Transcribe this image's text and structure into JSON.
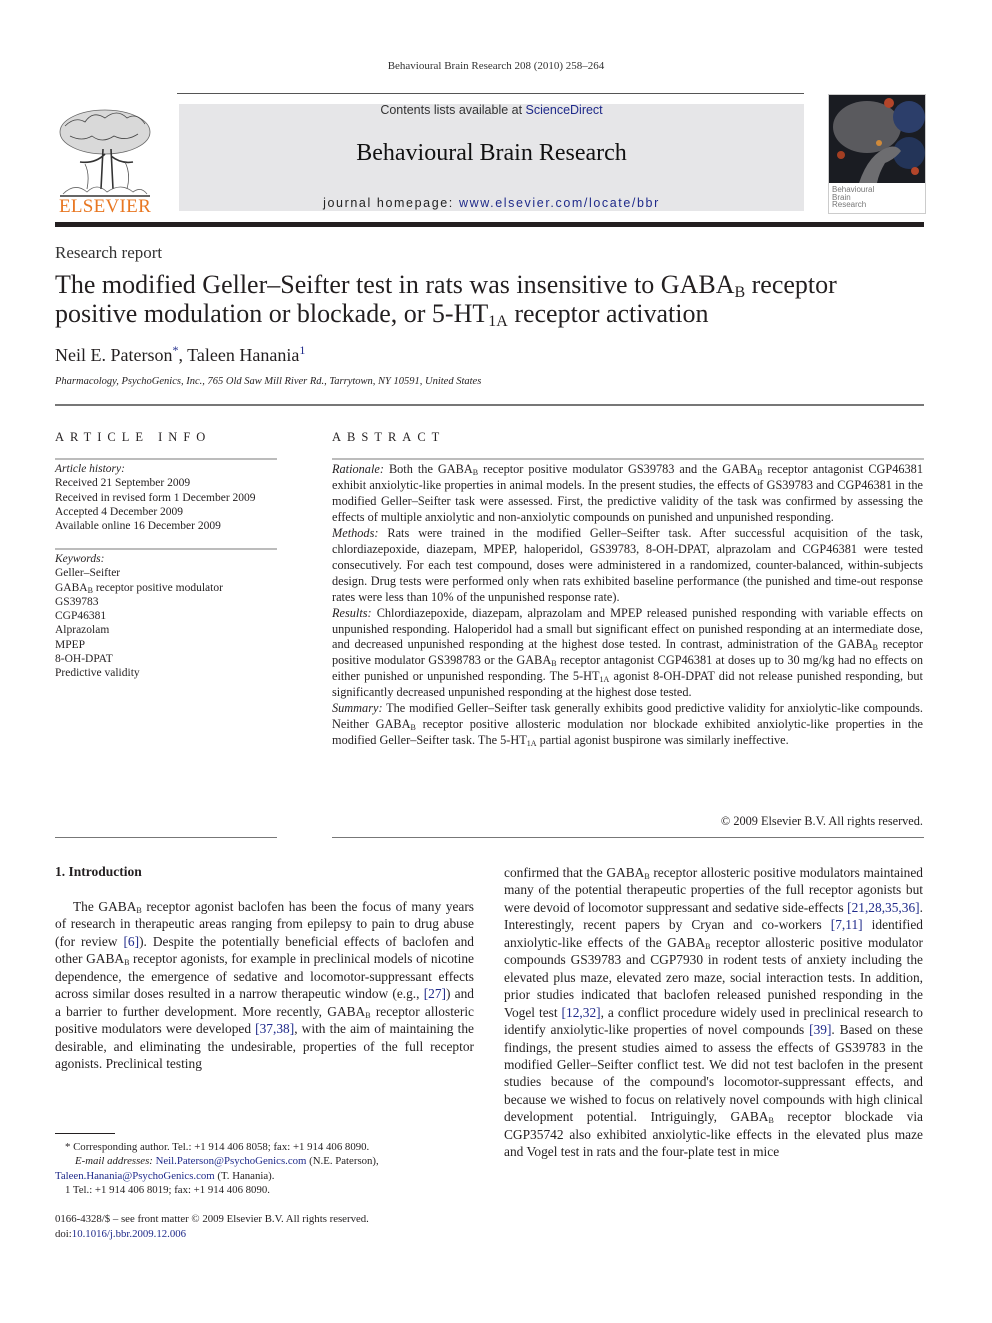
{
  "header": {
    "running_head": "Behavioural Brain Research 208 (2010) 258–264",
    "contents_prefix": "Contents lists available at ",
    "contents_link": "ScienceDirect",
    "journal_title": "Behavioural Brain Research",
    "homepage_prefix": "journal homepage: ",
    "homepage_link": "www.elsevier.com/locate/bbr",
    "publisher_logo_text": "ELSEVIER",
    "cover_text": [
      "Behavioural",
      "Brain",
      "Research"
    ],
    "colors": {
      "elsevier_orange": "#e87722",
      "link_blue": "#1f2a8a",
      "banner_gray": "#e6e6e8"
    }
  },
  "article": {
    "type": "Research report",
    "title_parts": {
      "t1": "The modified Geller–Seifter test in rats was insensitive to GABA",
      "t1_sub": "B",
      "t2": " receptor positive modulation or blockade, or 5-HT",
      "t2_sub": "1A",
      "t3": " receptor activation"
    },
    "authors": [
      {
        "name": "Neil E. Paterson",
        "mark": "*"
      },
      {
        "name": "Taleen Hanania",
        "mark": "1"
      }
    ],
    "author_separator": ", ",
    "affiliation": "Pharmacology, PsychoGenics, Inc., 765 Old Saw Mill River Rd., Tarrytown, NY 10591, United States"
  },
  "article_info": {
    "heading": "ARTICLE INFO",
    "history_label": "Article history:",
    "history": [
      "Received 21 September 2009",
      "Received in revised form 1 December 2009",
      "Accepted 4 December 2009",
      "Available online 16 December 2009"
    ],
    "keywords_label": "Keywords:",
    "keywords": [
      "Geller–Seifter",
      "GABA_B receptor positive modulator",
      "GS39783",
      "CGP46381",
      "Alprazolam",
      "MPEP",
      "8-OH-DPAT",
      "Predictive validity"
    ],
    "keyword_gabab": {
      "pre": "GABA",
      "sub": "B",
      "post": " receptor positive modulator"
    }
  },
  "abstract": {
    "heading": "ABSTRACT",
    "rationale_label": "Rationale:",
    "rationale": {
      "a": " Both the GABA",
      "b": " receptor positive modulator GS39783 and the GABA",
      "c": " receptor antagonist CGP46381 exhibit anxiolytic-like properties in animal models. In the present studies, the effects of GS39783 and CGP46381 in the modified Geller–Seifter task were assessed. First, the predictive validity of the task was confirmed by assessing the effects of multiple anxiolytic and non-anxiolytic compounds on punished and unpunished responding.",
      "sub": "B"
    },
    "methods_label": "Methods:",
    "methods": " Rats were trained in the modified Geller–Seifter task. After successful acquisition of the task, chlordiazepoxide, diazepam, MPEP, haloperidol, GS39783, 8-OH-DPAT, alprazolam and CGP46381 were tested consecutively. For each test compound, doses were administered in a randomized, counter-balanced, within-subjects design. Drug tests were performed only when rats exhibited baseline performance (the punished and time-out response rates were less than 10% of the unpunished response rate).",
    "results_label": "Results:",
    "results": {
      "a": " Chlordiazepoxide, diazepam, alprazolam and MPEP released punished responding with variable effects on unpunished responding. Haloperidol had a small but significant effect on punished responding at an intermediate dose, and decreased unpunished responding at the highest dose tested. In contrast, administration of the GABA",
      "b": " receptor positive modulator GS398783 or the GABA",
      "c": " receptor antagonist CGP46381 at doses up to 30 mg/kg had no effects on either punished or unpunished responding. The 5-HT",
      "d": " agonist 8-OH-DPAT did not release punished responding, but significantly decreased unpunished responding at the highest dose tested.",
      "sub_b": "B",
      "sub_1a": "1A"
    },
    "summary_label": "Summary:",
    "summary": {
      "a": " The modified Geller–Seifter task generally exhibits good predictive validity for anxiolytic-like compounds. Neither GABA",
      "b": " receptor positive allosteric modulation nor blockade exhibited anxiolytic-like properties in the modified Geller–Seifter task. The 5-HT",
      "c": " partial agonist buspirone was similarly ineffective.",
      "sub_b": "B",
      "sub_1a": "1A"
    },
    "copyright": "© 2009 Elsevier B.V. All rights reserved."
  },
  "intro": {
    "heading": "1.  Introduction",
    "left": {
      "s1": "The GABA",
      "s2": " receptor agonist baclofen has been the focus of many years of research in therapeutic areas ranging from epilepsy to pain to drug abuse (for review ",
      "ref1": "[6]",
      "s3": "). Despite the potentially beneficial effects of baclofen and other GABA",
      "s4": " receptor agonists, for example in preclinical models of nicotine dependence, the emergence of sedative and locomotor-suppressant effects across similar doses resulted in a narrow therapeutic window (e.g., ",
      "ref2": "[27]",
      "s5": ") and a barrier to further development. More recently, GABA",
      "s6": " receptor allosteric positive modulators were developed ",
      "ref3": "[37,38]",
      "s7": ", with the aim of maintaining the desirable, and eliminating the undesirable, properties of the full receptor agonists. Preclinical testing",
      "sub": "B"
    },
    "right": {
      "s1": "confirmed that the GABA",
      "s2": " receptor allosteric positive modulators maintained many of the potential therapeutic properties of the full receptor agonists but were devoid of locomotor suppressant and sedative side-effects ",
      "ref1": "[21,28,35,36]",
      "s3": ". Interestingly, recent papers by Cryan and co-workers ",
      "ref2": "[7,11]",
      "s4": " identified anxiolytic-like effects of the GABA",
      "s5": " receptor allosteric positive modulator compounds GS39783 and CGP7930 in rodent tests of anxiety including the elevated plus maze, elevated zero maze, social interaction tests. In addition, prior studies indicated that baclofen released punished responding in the Vogel test ",
      "ref3": "[12,32]",
      "s6": ", a conflict procedure widely used in preclinical research to identify anxiolytic-like properties of novel compounds ",
      "ref4": "[39]",
      "s7": ". Based on these findings, the present studies aimed to assess the effects of GS39783 in the modified Geller–Seifter conflict test. We did not test baclofen in the present studies because of the compound's locomotor-suppressant effects, and because we wished to focus on relatively novel compounds with high clinical development potential. Intriguingly, GABA",
      "s8": " receptor blockade via CGP35742 also exhibited anxiolytic-like effects in the elevated plus maze and Vogel test in rats and the four-plate test in mice",
      "sub": "B"
    }
  },
  "footnotes": {
    "corresponding": "* Corresponding author. Tel.: +1 914 406 8058; fax: +1 914 406 8090.",
    "email_label": "E-mail addresses:",
    "email1": "Neil.Paterson@PsychoGenics.com",
    "email1_who": " (N.E. Paterson),",
    "email2": "Taleen.Hanania@PsychoGenics.com",
    "email2_who": " (T. Hanania).",
    "fn1": "1 Tel.: +1 914 406 8019; fax: +1 914 406 8090.",
    "issn": "0166-4328/$ – see front matter © 2009 Elsevier B.V. All rights reserved.",
    "doi_prefix": "doi:",
    "doi": "10.1016/j.bbr.2009.12.006"
  }
}
